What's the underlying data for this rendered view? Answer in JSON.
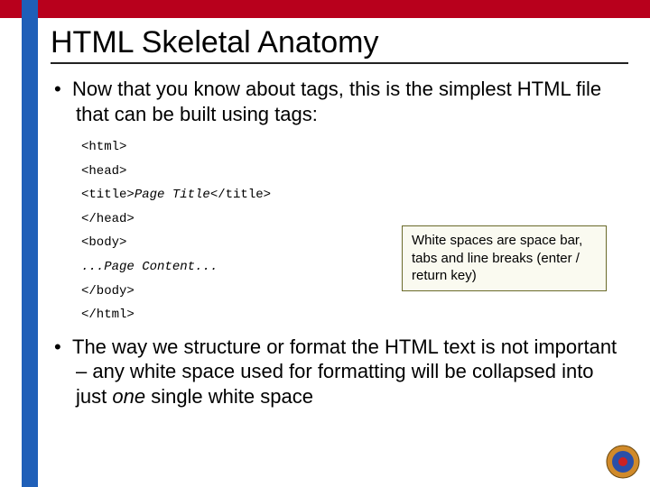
{
  "title": "HTML Skeletal Anatomy",
  "bullet1": "Now that you know about tags, this is the simplest HTML file that can be built using tags:",
  "code": {
    "l1": "<html>",
    "l2": "<head>",
    "l3a": "<title>",
    "l3b": "Page Title",
    "l3c": "</title>",
    "l4": "</head>",
    "l5": "<body>",
    "l6": "...Page Content...",
    "l7": "</body>",
    "l8": "</html>"
  },
  "callout": "White spaces are space bar, tabs and line breaks (enter / return key)",
  "bullet2a": "The way we structure or format the HTML text is not important – any white space used for formatting will be collapsed into just ",
  "bullet2b": "one",
  "bullet2c": " single white space"
}
